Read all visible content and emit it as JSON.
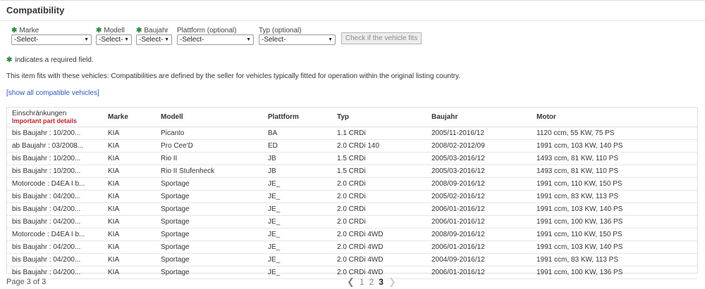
{
  "section_title": "Compatibility",
  "filters": [
    {
      "label": "Marke",
      "required": true,
      "value": "-Select-"
    },
    {
      "label": "Modell",
      "required": true,
      "value": "-Select-"
    },
    {
      "label": "Baujahr",
      "required": true,
      "value": "-Select-"
    },
    {
      "label": "Plattform (optional)",
      "required": false,
      "value": "-Select-"
    },
    {
      "label": "Typ (optional)",
      "required": false,
      "value": "-Select-"
    }
  ],
  "check_button": "Check if the vehicle fits",
  "required_note": "indicates a required field.",
  "fits_text": "This item fits with these vehicles: Compatibilities are defined by the seller for vehicles typically fitted for operation within the original listing country.",
  "show_all_link": "[show all compatible vehicles]",
  "table": {
    "headers": [
      "Einschränkungen",
      "Marke",
      "Modell",
      "Plattform",
      "Typ",
      "Baujahr",
      "Motor"
    ],
    "header_sub": "Important part details",
    "rows": [
      [
        "bis Baujahr : 10/200...",
        "KIA",
        "Picanto",
        "BA",
        "1.1 CRDi",
        "2005/11-2016/12",
        "1120 ccm, 55 KW, 75 PS"
      ],
      [
        "ab Baujahr : 03/2008...",
        "KIA",
        "Pro Cee'D",
        "ED",
        "2.0 CRDi 140",
        "2008/02-2012/09",
        "1991 ccm, 103 KW, 140 PS"
      ],
      [
        "bis Baujahr : 10/200...",
        "KIA",
        "Rio II",
        "JB",
        "1.5 CRDi",
        "2005/03-2016/12",
        "1493 ccm, 81 KW, 110 PS"
      ],
      [
        "bis Baujahr : 10/200...",
        "KIA",
        "Rio II Stufenheck",
        "JB",
        "1.5 CRDi",
        "2005/03-2016/12",
        "1493 ccm, 81 KW, 110 PS"
      ],
      [
        "Motorcode : D4EA I b...",
        "KIA",
        "Sportage",
        "JE_",
        "2.0 CRDi",
        "2008/09-2016/12",
        "1991 ccm, 110 KW, 150 PS"
      ],
      [
        "bis Baujahr : 04/200...",
        "KIA",
        "Sportage",
        "JE_",
        "2.0 CRDi",
        "2005/02-2016/12",
        "1991 ccm, 83 KW, 113 PS"
      ],
      [
        "bis Baujahr : 04/200...",
        "KIA",
        "Sportage",
        "JE_",
        "2.0 CRDi",
        "2006/01-2016/12",
        "1991 ccm, 103 KW, 140 PS"
      ],
      [
        "bis Baujahr : 04/200...",
        "KIA",
        "Sportage",
        "JE_",
        "2.0 CRDi",
        "2006/01-2016/12",
        "1991 ccm, 100 KW, 136 PS"
      ],
      [
        "Motorcode : D4EA I b...",
        "KIA",
        "Sportage",
        "JE_",
        "2.0 CRDi 4WD",
        "2008/09-2016/12",
        "1991 ccm, 110 KW, 150 PS"
      ],
      [
        "bis Baujahr : 04/200...",
        "KIA",
        "Sportage",
        "JE_",
        "2.0 CRDi 4WD",
        "2006/01-2016/12",
        "1991 ccm, 103 KW, 140 PS"
      ],
      [
        "bis Baujahr : 04/200...",
        "KIA",
        "Sportage",
        "JE_",
        "2.0 CRDi 4WD",
        "2004/09-2016/12",
        "1991 ccm, 83 KW, 113 PS"
      ],
      [
        "bis Baujahr : 04/200...",
        "KIA",
        "Sportage",
        "JE_",
        "2.0 CRDi 4WD",
        "2006/01-2016/12",
        "1991 ccm, 100 KW, 136 PS"
      ]
    ]
  },
  "pagination": {
    "status": "Page 3 of 3",
    "pages": [
      "1",
      "2",
      "3"
    ],
    "current": "3",
    "prev_icon": "chevron-left-icon",
    "next_icon": "chevron-right-icon"
  },
  "colors": {
    "required_star": "#2c8a3c",
    "link": "#2a56c6",
    "important": "#c8232c"
  }
}
